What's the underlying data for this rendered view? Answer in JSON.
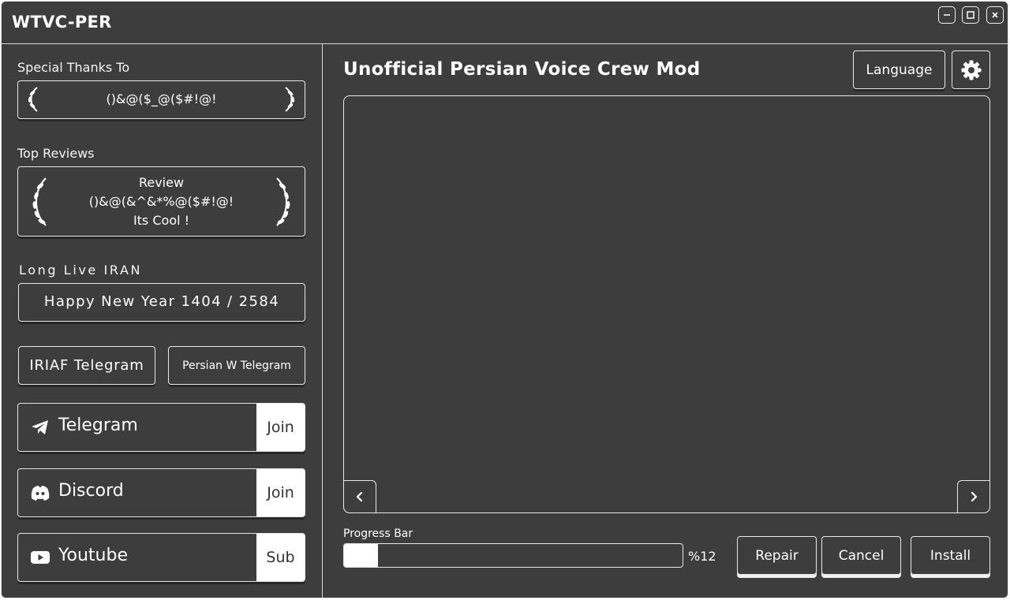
{
  "window": {
    "title": "WTVC-PER"
  },
  "sidebar": {
    "special_thanks_label": "Special Thanks To",
    "special_thanks_value": "()&@($_@($#!@!",
    "top_reviews_label": "Top Reviews",
    "review_line1": "Review",
    "review_line2": "()&@(&^&*%@($#!@!",
    "review_line3": "Its Cool !",
    "slogan": "Long Live IRAN",
    "new_year": "Happy New Year 1404  / 2584",
    "iriaf_telegram": "IRIAF Telegram",
    "persian_w_telegram": "Persian W Telegram",
    "socials": [
      {
        "label": "Telegram",
        "action": "Join",
        "icon": "telegram-icon"
      },
      {
        "label": "Discord",
        "action": "Join",
        "icon": "discord-icon"
      },
      {
        "label": "Youtube",
        "action": "Sub",
        "icon": "youtube-icon"
      }
    ]
  },
  "main": {
    "title": "Unofficial Persian Voice Crew Mod",
    "language_button": "Language",
    "progress_label": "Progress Bar",
    "progress_percent_text": "%12",
    "progress_value": 0.1,
    "buttons": {
      "repair": "Repair",
      "cancel": "Cancel",
      "install": "Install"
    }
  },
  "colors": {
    "background": "#3d3d3d",
    "border": "#e8e8e8",
    "text": "#ffffff",
    "button_fill": "#ffffff"
  }
}
